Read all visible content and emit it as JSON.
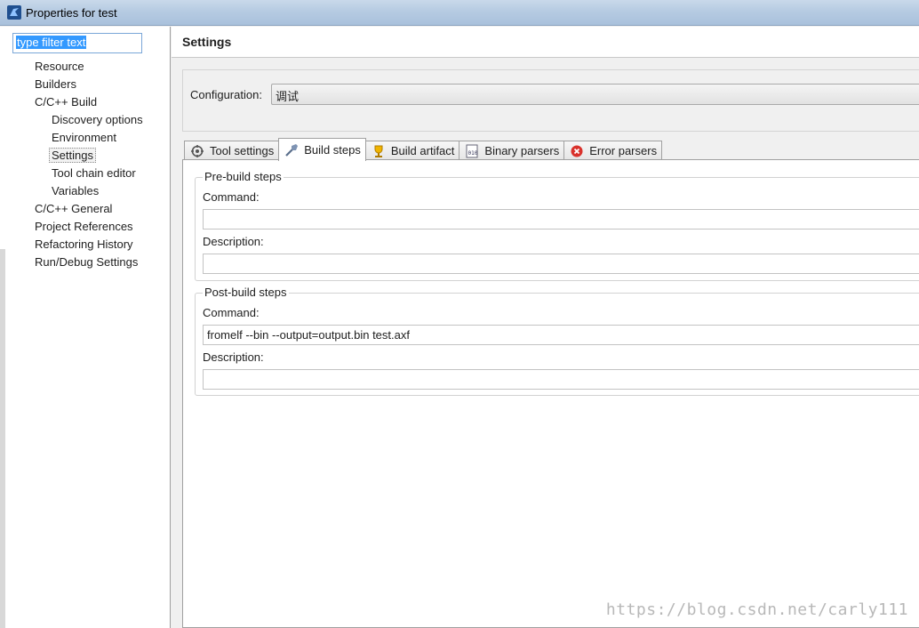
{
  "window": {
    "title": "Properties for test"
  },
  "sidebar": {
    "filter_placeholder": "type filter text",
    "items": [
      {
        "label": "Resource"
      },
      {
        "label": "Builders"
      },
      {
        "label": "C/C++ Build"
      },
      {
        "label": "Discovery options"
      },
      {
        "label": "Environment"
      },
      {
        "label": "Settings"
      },
      {
        "label": "Tool chain editor"
      },
      {
        "label": "Variables"
      },
      {
        "label": "C/C++ General"
      },
      {
        "label": "Project References"
      },
      {
        "label": "Refactoring History"
      },
      {
        "label": "Run/Debug Settings"
      }
    ]
  },
  "main": {
    "title": "Settings",
    "configuration_label": "Configuration:",
    "configuration_value": "调试",
    "tabs": [
      {
        "label": "Tool settings",
        "icon": "tool-settings-icon"
      },
      {
        "label": "Build steps",
        "icon": "build-steps-icon"
      },
      {
        "label": "Build artifact",
        "icon": "build-artifact-icon"
      },
      {
        "label": "Binary parsers",
        "icon": "binary-parsers-icon"
      },
      {
        "label": "Error parsers",
        "icon": "error-parsers-icon"
      }
    ],
    "pre_build": {
      "legend": "Pre-build steps",
      "command_label": "Command:",
      "command_value": "",
      "description_label": "Description:",
      "description_value": ""
    },
    "post_build": {
      "legend": "Post-build steps",
      "command_label": "Command:",
      "command_value": "fromelf --bin --output=output.bin test.axf",
      "description_label": "Description:",
      "description_value": ""
    }
  },
  "watermark": "https://blog.csdn.net/carly111"
}
